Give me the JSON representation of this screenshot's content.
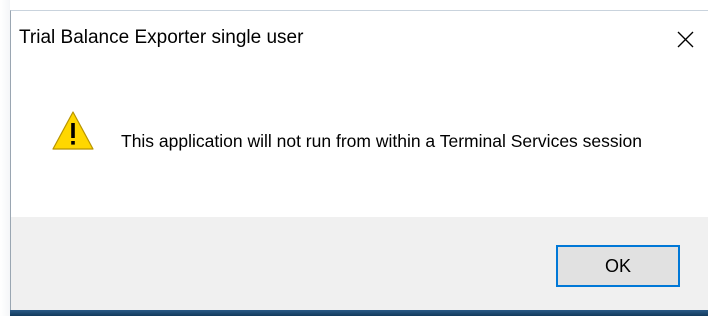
{
  "dialog": {
    "title": "Trial Balance Exporter single user",
    "message": "This application will not run from within a Terminal Services session",
    "icon": "warning-icon",
    "buttons": {
      "ok_label": "OK"
    },
    "close_icon": "close-icon"
  },
  "colors": {
    "button_focus_border": "#0078d7",
    "footer_background": "#f0f0f0",
    "warning_fill": "#ffd700"
  }
}
